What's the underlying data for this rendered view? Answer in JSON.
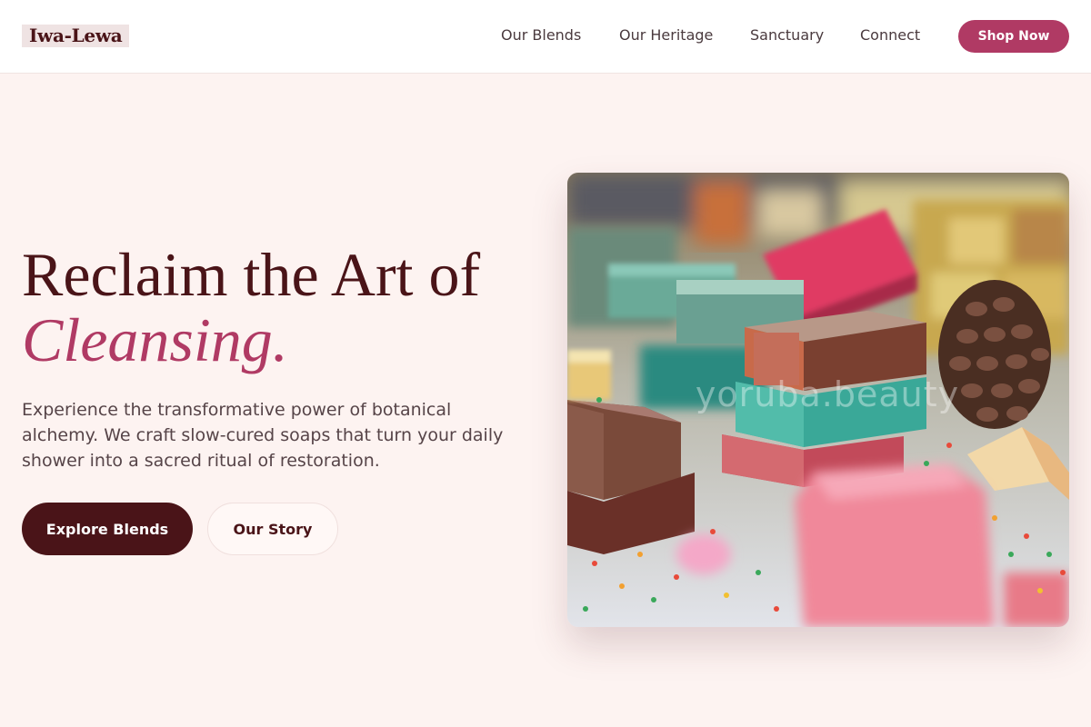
{
  "brand": {
    "name": "Iwa-Lewa"
  },
  "nav": {
    "items": [
      {
        "label": "Our Blends"
      },
      {
        "label": "Our Heritage"
      },
      {
        "label": "Sanctuary"
      },
      {
        "label": "Connect"
      }
    ],
    "cta_label": "Shop Now"
  },
  "hero": {
    "headline_line1": "Reclaim the Art of",
    "headline_accent": "Cleansing.",
    "subtitle": "Experience the transformative power of botanical alchemy. We craft slow-cured soaps that turn your daily shower into a sacred ritual of restoration.",
    "primary_button": "Explore Blends",
    "secondary_button": "Our Story",
    "image_watermark": "yoruba.beauty"
  },
  "colors": {
    "background": "#fdf3f1",
    "accent": "#b03a64",
    "dark": "#4a1418"
  }
}
